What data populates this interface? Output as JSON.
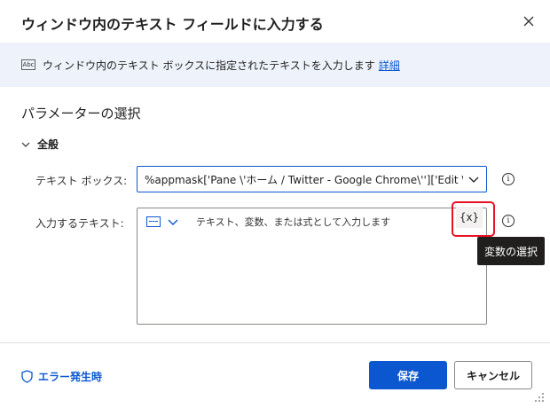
{
  "dialog": {
    "title": "ウィンドウ内のテキスト フィールドに入力する",
    "close_icon": "close-icon"
  },
  "banner": {
    "icon": "abc-icon",
    "icon_text": "Abc",
    "text": "ウィンドウ内のテキスト ボックスに指定されたテキストを入力します",
    "link": "詳細"
  },
  "section": {
    "title": "パラメーターの選択"
  },
  "group": {
    "label": "全般"
  },
  "fields": {
    "textbox": {
      "label": "テキスト ボックス:",
      "value": "%appmask['Pane \\'ホーム / Twitter - Google Chrome\\'']['Edit \\'テキス"
    },
    "input_text": {
      "label": "入力するテキスト:",
      "placeholder": "テキスト、変数、または式として入力します",
      "variable_button": "{x}"
    }
  },
  "tooltip": {
    "text": "変数の選択"
  },
  "footer": {
    "on_error": "エラー発生時",
    "save": "保存",
    "cancel": "キャンセル"
  },
  "colors": {
    "accent": "#0b57d0",
    "banner_bg": "#eef3fb",
    "highlight": "#e81123",
    "tooltip_bg": "#201f1e"
  }
}
